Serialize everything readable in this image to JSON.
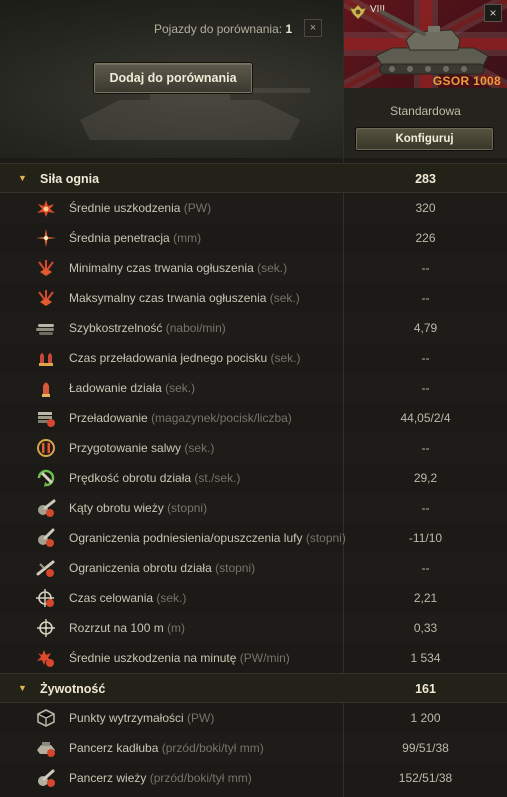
{
  "header": {
    "compare_label": "Pojazdy do porównania:",
    "compare_count": "1",
    "close_glyph": "×",
    "add_button": "Dodaj do porównania"
  },
  "tank": {
    "tier": "VIII",
    "name": "GSOR 1008",
    "config": "Standardowa",
    "configure_button": "Konfiguruj",
    "close_glyph": "×",
    "flag_icon": "union-jack-icon",
    "tank_icon": "tank-icon"
  },
  "colors": {
    "accent_orange": "#f29a3a",
    "section_chevron": "#e3b453",
    "icon_red": "#d83a2a"
  },
  "sections": [
    {
      "title": "Siła ognia",
      "value": "283",
      "chevron": "▼",
      "rows": [
        {
          "label": "Średnie uszkodzenia",
          "unit": "(PW)",
          "value": "320",
          "icon": "damage-icon"
        },
        {
          "label": "Średnia penetracja",
          "unit": "(mm)",
          "value": "226",
          "icon": "penetration-icon"
        },
        {
          "label": "Minimalny czas trwania ogłuszenia",
          "unit": "(sek.)",
          "value": "--",
          "icon": "stun-min-icon"
        },
        {
          "label": "Maksymalny czas trwania ogłuszenia",
          "unit": "(sek.)",
          "value": "--",
          "icon": "stun-max-icon"
        },
        {
          "label": "Szybkostrzelność",
          "unit": "(naboi/min)",
          "value": "4,79",
          "icon": "rate-of-fire-icon"
        },
        {
          "label": "Czas przeładowania jednego pocisku",
          "unit": "(sek.)",
          "value": "--",
          "icon": "shell-reload-icon"
        },
        {
          "label": "Ładowanie działa",
          "unit": "(sek.)",
          "value": "--",
          "icon": "gun-loading-icon"
        },
        {
          "label": "Przeładowanie",
          "unit": "(magazynek/pocisk/liczba)",
          "value": "44,05/2/4",
          "icon": "magazine-reload-icon"
        },
        {
          "label": "Przygotowanie salwy",
          "unit": "(sek.)",
          "value": "--",
          "icon": "salvo-icon"
        },
        {
          "label": "Prędkość obrotu działa",
          "unit": "(st./sek.)",
          "value": "29,2",
          "icon": "gun-traverse-speed-icon"
        },
        {
          "label": "Kąty obrotu wieży",
          "unit": "(stopni)",
          "value": "--",
          "icon": "turret-angle-icon"
        },
        {
          "label": "Ograniczenia podniesienia/opuszczenia lufy",
          "unit": "(stopni)",
          "value": "-11/10",
          "icon": "elevation-icon"
        },
        {
          "label": "Ograniczenia obrotu działa",
          "unit": "(stopni)",
          "value": "--",
          "icon": "gun-traverse-limit-icon"
        },
        {
          "label": "Czas celowania",
          "unit": "(sek.)",
          "value": "2,21",
          "icon": "aiming-time-icon"
        },
        {
          "label": "Rozrzut na 100 m",
          "unit": "(m)",
          "value": "0,33",
          "icon": "dispersion-icon"
        },
        {
          "label": "Średnie uszkodzenia na minutę",
          "unit": "(PW/min)",
          "value": "1 534",
          "icon": "dpm-icon"
        }
      ]
    },
    {
      "title": "Żywotność",
      "value": "161",
      "chevron": "▼",
      "rows": [
        {
          "label": "Punkty wytrzymałości",
          "unit": "(PW)",
          "value": "1 200",
          "icon": "hitpoints-icon"
        },
        {
          "label": "Pancerz kadłuba",
          "unit": "(przód/boki/tył mm)",
          "value": "99/51/38",
          "icon": "hull-armor-icon"
        },
        {
          "label": "Pancerz wieży",
          "unit": "(przód/boki/tył mm)",
          "value": "152/51/38",
          "icon": "turret-armor-icon"
        }
      ]
    }
  ]
}
